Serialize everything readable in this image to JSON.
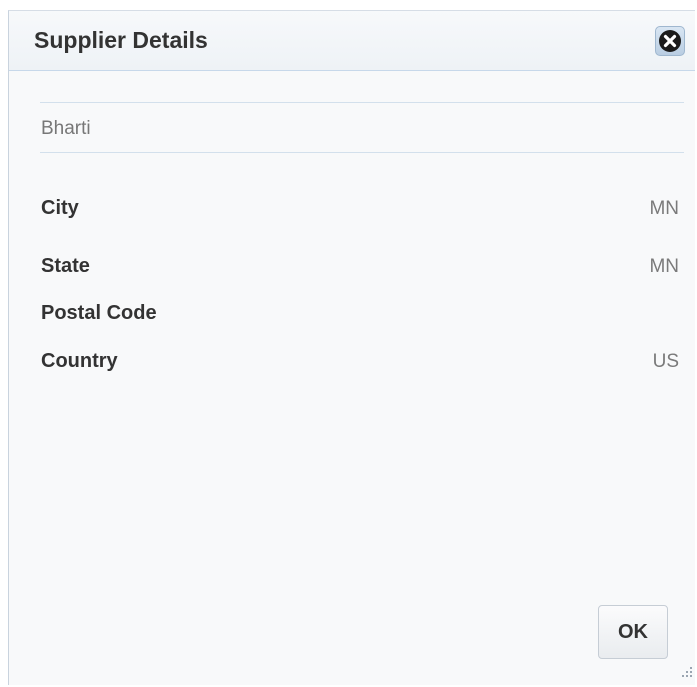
{
  "dialog": {
    "title": "Supplier Details",
    "close_icon": "close-circle-icon",
    "supplier_name": "Bharti",
    "fields": [
      {
        "label": "City",
        "value": "MN"
      },
      {
        "label": "State",
        "value": "MN"
      },
      {
        "label": "Postal Code",
        "value": ""
      },
      {
        "label": "Country",
        "value": "US"
      }
    ],
    "ok_label": "OK",
    "resize_icon": "resize-grip-icon"
  }
}
